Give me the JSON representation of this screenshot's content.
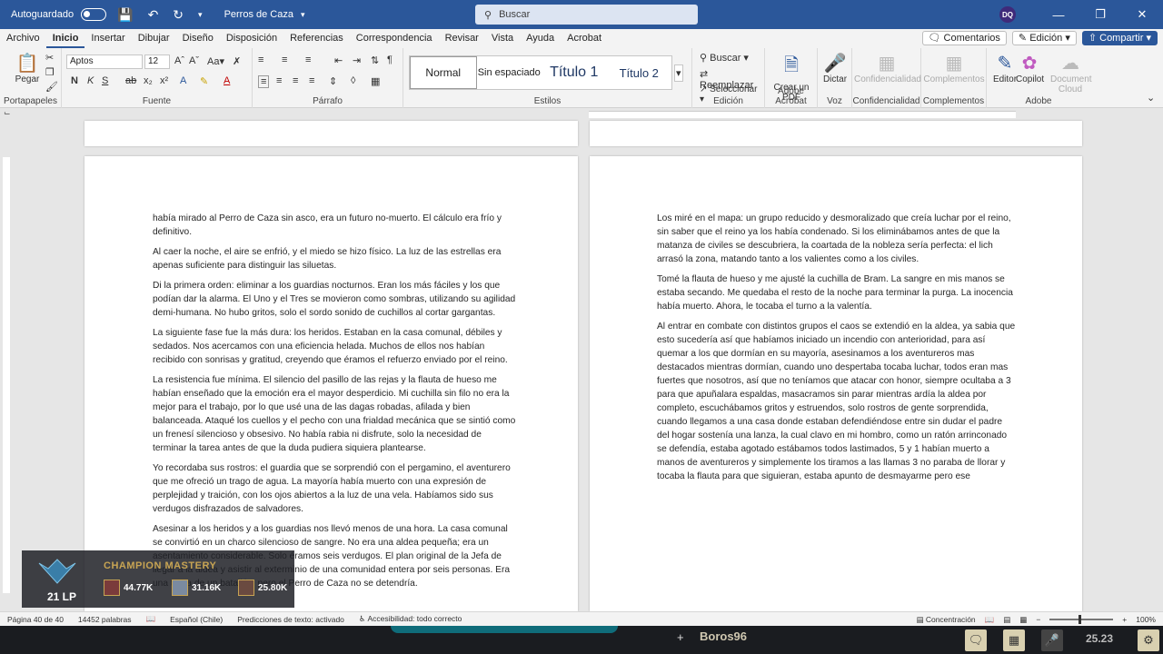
{
  "titlebar": {
    "autosave_label": "Autoguardado",
    "doc_title": "Perros de Caza",
    "search_placeholder": "Buscar",
    "user_initials": "DQ"
  },
  "menu": {
    "items": [
      "Archivo",
      "Inicio",
      "Insertar",
      "Dibujar",
      "Diseño",
      "Disposición",
      "Referencias",
      "Correspondencia",
      "Revisar",
      "Vista",
      "Ayuda",
      "Acrobat"
    ],
    "comments": "Comentarios",
    "edit_mode": "Edición",
    "share": "Compartir"
  },
  "ribbon": {
    "paste": "Pegar",
    "clipboard": "Portapapeles",
    "font_name": "Aptos",
    "font_size": "12",
    "font_group": "Fuente",
    "paragraph_group": "Párrafo",
    "styles": [
      "Normal",
      "Sin espaciado",
      "Título 1",
      "Título 2"
    ],
    "styles_group": "Estilos",
    "find": "Buscar",
    "replace": "Reemplazar",
    "select": "Seleccionar",
    "edit_group": "Edición",
    "create_pdf": "Crear un PDF",
    "acrobat_group": "Adobe Acrobat",
    "dictate": "Dictar",
    "voice_group": "Voz",
    "confidentiality": "Confidencialidad",
    "confidentiality_group": "Confidencialidad",
    "addins": "Complementos",
    "addins_group": "Complementos",
    "editor": "Editor",
    "copilot": "Copilot",
    "doc_cloud": "Document Cloud",
    "adobe_group": "Adobe"
  },
  "left_page": {
    "paragraphs": [
      "había mirado al Perro de Caza sin asco, era un futuro no-muerto. El cálculo era frío y definitivo.",
      "Al caer la noche, el aire se enfrió, y el miedo se hizo físico. La luz de las estrellas era apenas suficiente para distinguir las siluetas.",
      "Di la primera orden: eliminar a los guardias nocturnos. Eran los más fáciles y los que podían dar la alarma. El Uno y el Tres se movieron como sombras, utilizando su agilidad demi-humana. No hubo gritos, solo el sordo sonido de cuchillos al cortar gargantas.",
      "La siguiente fase fue la más dura: los heridos. Estaban en la casa comunal, débiles y sedados. Nos acercamos con una eficiencia helada. Muchos de ellos nos habían recibido con sonrisas y gratitud, creyendo que éramos el refuerzo enviado por el reino.",
      "La resistencia fue mínima. El silencio del pasillo de las rejas y la flauta de hueso me habían enseñado que la emoción era el mayor desperdicio. Mi cuchilla sin filo no era la mejor para el trabajo, por lo que usé una de las dagas robadas, afilada y bien balanceada. Ataqué los cuellos y el pecho con una frialdad mecánica que se sintió como un frenesí silencioso y obsesivo. No había rabia ni disfrute, solo la necesidad de terminar la tarea antes de que la duda pudiera siquiera plantearse.",
      "Yo recordaba sus rostros: el guardia que se sorprendió con el pergamino, el aventurero que me ofreció un trago de agua. La mayoría había muerto con una expresión de perplejidad y traición, con los ojos abiertos a la luz de una vela. Habíamos sido sus verdugos disfrazados de salvadores.",
      "Asesinar a los heridos y a los guardias nos llevó menos de una hora. La casa comunal se convirtió en un charco silencioso de sangre. No era una aldea pequeña; era un asentamiento considerable. Solo éramos seis verdugos. El plan original de la Jefa de llegar a la aldea y asistir al exterminio de una comunidad entera por seis personas. Era una tarea de un batallón, pero el Perro de Caza no se detendría."
    ]
  },
  "right_page": {
    "paragraphs": [
      "Los miré en el mapa: un grupo reducido y desmoralizado que creía luchar por el reino, sin saber que el reino ya los había condenado. Si los eliminábamos antes de que la matanza de civiles se descubriera, la coartada de la nobleza sería perfecta: el lich arrasó la zona, matando tanto a los valientes como a los civiles.",
      "Tomé la flauta de hueso y me ajusté la cuchilla de Bram. La sangre en mis manos se estaba secando. Me quedaba el resto de la noche para terminar la purga. La inocencia había muerto. Ahora, le tocaba el turno a la valentía.",
      "Al entrar en combate con distintos grupos el caos se extendió en la aldea, ya sabia que esto sucedería así que habíamos iniciado un incendio con anterioridad, para así quemar a los que dormían en su mayoría, asesinamos a los aventureros mas destacados mientras dormían, cuando uno despertaba tocaba luchar, todos eran mas fuertes que nosotros, así que no teníamos que atacar con honor, siempre ocultaba a 3 para que apuñalara espaldas, masacramos sin parar mientras ardía la aldea por completo, escuchábamos gritos y estruendos, solo rostros de gente sorprendida, cuando llegamos a una casa donde estaban defendiéndose entre sin dudar el padre del hogar sostenía una lanza, la cual clavo en mi hombro, como un ratón arrinconado se defendía, estaba agotado estábamos todos lastimados, 5 y 1 habían muerto a manos de aventureros y simplemente los tiramos a las llamas 3 no paraba de llorar y tocaba la flauta para que siguieran, estaba apunto de desmayarme pero ese"
    ]
  },
  "status": {
    "page": "Página 40 de 40",
    "words": "14452 palabras",
    "language": "Español (Chile)",
    "predictions": "Predicciones de texto: activado",
    "accessibility": "Accesibilidad: todo correcto",
    "focus": "Concentración",
    "zoom": "100%"
  },
  "overlay": {
    "title": "CHAMPION MASTERY",
    "lp": "21 LP",
    "stats": [
      "44.77K",
      "31.16K",
      "25.80K"
    ]
  },
  "taskbar": {
    "game_label": "Boros96",
    "clock": "25.23"
  }
}
